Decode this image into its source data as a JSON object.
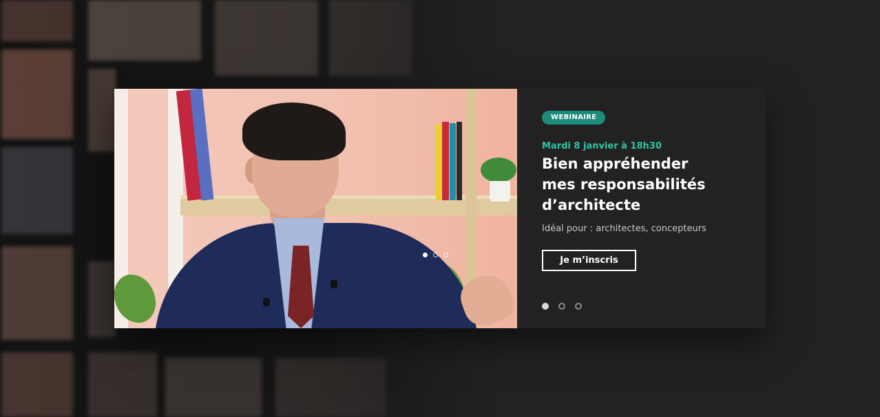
{
  "hero": {
    "badge": "WEBINAIRE",
    "date": "Mardi 8 janvier à 18h30",
    "title_lines": [
      "Bien appréhender",
      "mes responsabilités",
      "d’architecte"
    ],
    "audience": "Idéal pour : architectes, concepteurs",
    "cta_label": "Je m’inscris",
    "slides_total": 3,
    "active_slide": 1
  },
  "colors": {
    "page_bg": "#222222",
    "panel_bg": "#222222",
    "accent_badge": "#1d8c7a",
    "accent_date": "#2fc2a7",
    "text_primary": "#ffffff",
    "text_secondary": "#c9c9c9"
  },
  "icons": {
    "slide_indicator": "dot-icon"
  }
}
